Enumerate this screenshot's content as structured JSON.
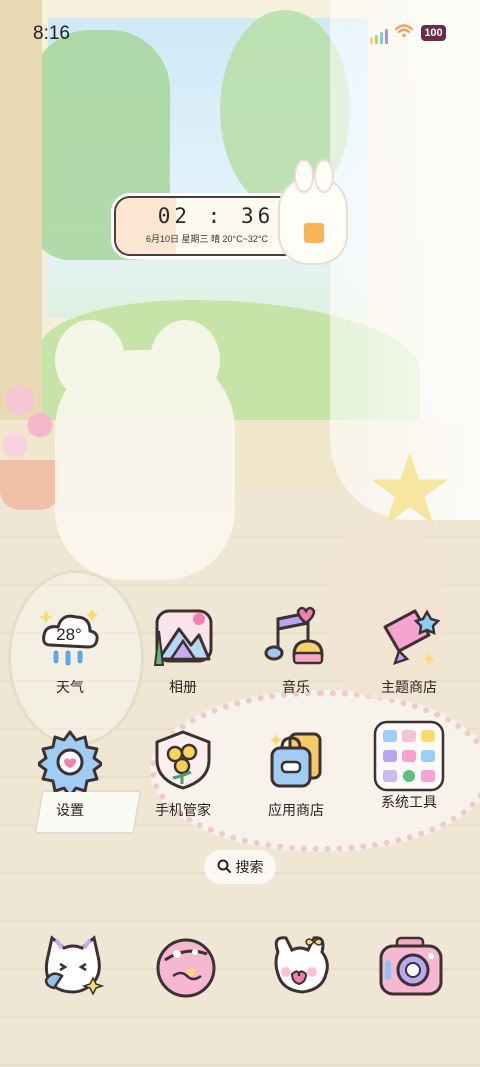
{
  "status_bar": {
    "time": "8:16",
    "battery": "100",
    "signal_colors": [
      "#f6d26a",
      "#a8d870",
      "#7fc6e8",
      "#b48ee0"
    ],
    "wifi_color": "#f4a05a"
  },
  "clock_widget": {
    "time": "02 : 36",
    "date_line": "6月10日 星期三  晴 20°C~32°C"
  },
  "apps": [
    {
      "label": "天气",
      "icon": "weather-cloud-icon",
      "value": "28°"
    },
    {
      "label": "相册",
      "icon": "gallery-mountain-icon"
    },
    {
      "label": "音乐",
      "icon": "music-note-icon"
    },
    {
      "label": "主题商店",
      "icon": "theme-store-icon"
    },
    {
      "label": "设置",
      "icon": "settings-gear-icon"
    },
    {
      "label": "手机管家",
      "icon": "phone-manager-icon"
    },
    {
      "label": "应用商店",
      "icon": "app-store-bag-icon"
    },
    {
      "label": "系统工具",
      "icon": "system-tools-folder-icon"
    }
  ],
  "search": {
    "label": "搜索",
    "icon": "search-icon"
  },
  "dock": [
    {
      "icon": "phone-cat-icon"
    },
    {
      "icon": "browser-planet-icon"
    },
    {
      "icon": "messages-bunny-icon"
    },
    {
      "icon": "camera-icon"
    }
  ],
  "colors": {
    "text": "#2b2222",
    "outline": "#3d3031",
    "pink": "#f3a3c4",
    "blue": "#a9d4f3",
    "yellow": "#f7dc6f"
  }
}
